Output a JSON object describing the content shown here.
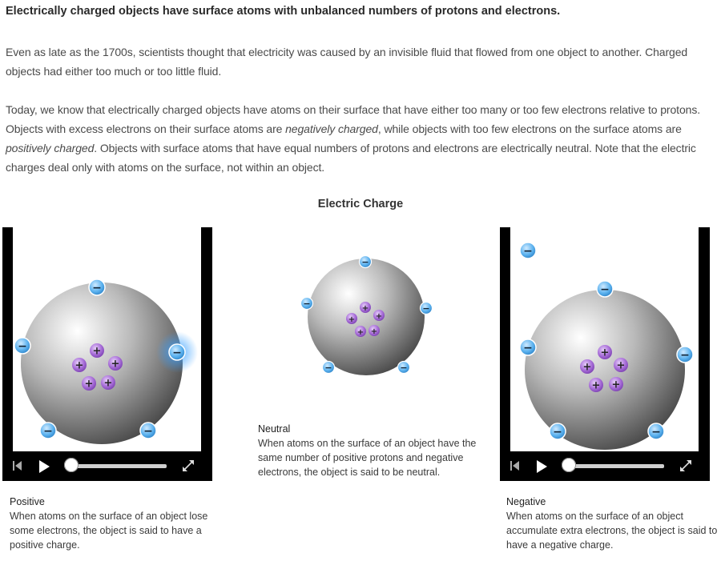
{
  "heading": "Electrically charged objects have surface atoms with unbalanced numbers of protons and electrons.",
  "paragraph1": "Even as late as the 1700s, scientists thought that electricity was caused by an invisible fluid that flowed from one object to another. Charged objects had either too much or too little fluid.",
  "paragraph2": {
    "part1": "Today, we know that electrically charged objects have atoms on their surface that have either too many or too few electrons relative to protons. Objects with excess electrons on their surface atoms are ",
    "em1": "negatively charged",
    "part2": ", while objects with too few electrons on the surface atoms are ",
    "em2": "positively charged",
    "part3": ". Objects with surface atoms that have equal numbers of protons and electrons are electrically neutral. Note that the electric charges deal only with atoms on the surface, not within an object."
  },
  "figure": {
    "title": "Electric Charge",
    "positive": {
      "title": "Positive",
      "text": "When atoms on the surface of an object lose some electrons, the object is said to have a positive charge."
    },
    "neutral": {
      "title": "Neutral",
      "text": "When atoms on the surface of an object have the same number of positive protons and negative electrons, the object is said to be neutral."
    },
    "negative": {
      "title": "Negative",
      "text": "When atoms on the surface of an object accumulate extra electrons, the object is said to have a negative charge."
    },
    "symbols": {
      "proton": "+",
      "electron": "−"
    },
    "icons": [
      "skip-back-icon",
      "play-icon",
      "expand-icon"
    ],
    "colors": {
      "electron": "#2d8fd8",
      "proton": "#9b59c9",
      "video_bg": "#000000"
    }
  }
}
